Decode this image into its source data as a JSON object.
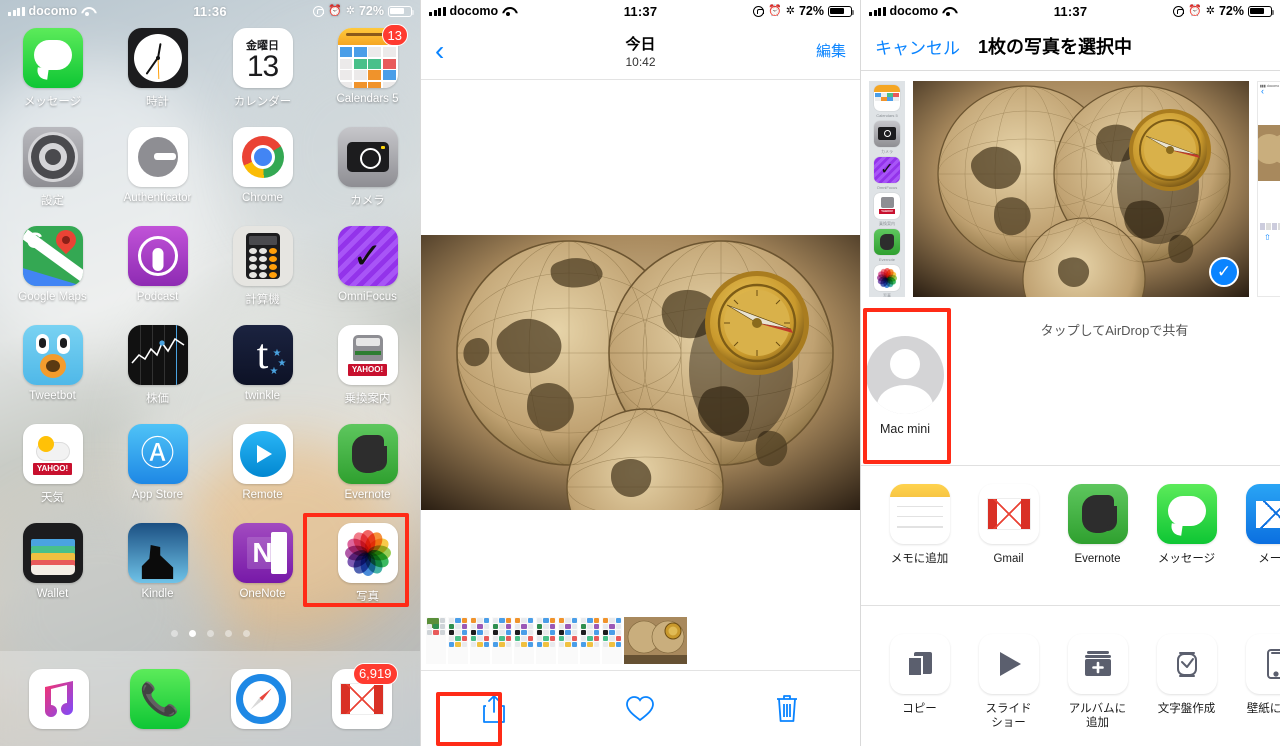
{
  "panel1": {
    "name": "ios-home-screen",
    "status": {
      "carrier": "docomo",
      "time": "11:36",
      "battery": "72%",
      "icons": [
        "rotation-lock-icon",
        "alarm-icon",
        "bluetooth-icon"
      ]
    },
    "apps": [
      {
        "label": "メッセージ",
        "icon": "messages-icon",
        "badge": ""
      },
      {
        "label": "時計",
        "icon": "clock-icon",
        "badge": ""
      },
      {
        "label": "カレンダー",
        "icon": "calendar-icon",
        "badge": "",
        "dow": "金曜日",
        "day": "13"
      },
      {
        "label": "Calendars 5",
        "icon": "calendars5-icon",
        "badge": "13"
      },
      {
        "label": "設定",
        "icon": "settings-icon",
        "badge": ""
      },
      {
        "label": "Authenticator",
        "icon": "authenticator-icon",
        "badge": ""
      },
      {
        "label": "Chrome",
        "icon": "chrome-icon",
        "badge": ""
      },
      {
        "label": "カメラ",
        "icon": "camera-icon",
        "badge": ""
      },
      {
        "label": "Google Maps",
        "icon": "google-maps-icon",
        "badge": ""
      },
      {
        "label": "Podcast",
        "icon": "podcasts-icon",
        "badge": ""
      },
      {
        "label": "計算機",
        "icon": "calculator-icon",
        "badge": ""
      },
      {
        "label": "OmniFocus",
        "icon": "omnifocus-icon",
        "badge": ""
      },
      {
        "label": "Tweetbot",
        "icon": "tweetbot-icon",
        "badge": ""
      },
      {
        "label": "株価",
        "icon": "stocks-icon",
        "badge": ""
      },
      {
        "label": "twinkle",
        "icon": "twinkle-icon",
        "badge": ""
      },
      {
        "label": "乗換案内",
        "icon": "norikae-annai-icon",
        "badge": ""
      },
      {
        "label": "天気",
        "icon": "yahoo-weather-icon",
        "badge": ""
      },
      {
        "label": "App Store",
        "icon": "app-store-icon",
        "badge": ""
      },
      {
        "label": "Remote",
        "icon": "remote-icon",
        "badge": ""
      },
      {
        "label": "Evernote",
        "icon": "evernote-icon",
        "badge": ""
      },
      {
        "label": "Wallet",
        "icon": "wallet-icon",
        "badge": ""
      },
      {
        "label": "Kindle",
        "icon": "kindle-icon",
        "badge": ""
      },
      {
        "label": "OneNote",
        "icon": "onenote-icon",
        "badge": ""
      },
      {
        "label": "写真",
        "icon": "photos-icon",
        "badge": ""
      }
    ],
    "page_dots": {
      "count": 5,
      "active_index": 1
    },
    "dock": [
      {
        "label": "",
        "icon": "music-icon",
        "badge": ""
      },
      {
        "label": "",
        "icon": "phone-icon",
        "badge": ""
      },
      {
        "label": "",
        "icon": "safari-icon",
        "badge": ""
      },
      {
        "label": "",
        "icon": "gmail-icon",
        "badge": "6,919"
      }
    ],
    "highlight": {
      "target": "写真",
      "color": "#ff2b17"
    }
  },
  "panel2": {
    "name": "photo-viewer",
    "status": {
      "carrier": "docomo",
      "time": "11:37",
      "battery": "72%"
    },
    "nav": {
      "back": "‹",
      "title": "今日",
      "subtitle": "10:42",
      "edit": "編集"
    },
    "photo_alt": "antique-world-map-with-compass",
    "toolbar": [
      {
        "name": "share-button",
        "icon": "share-icon"
      },
      {
        "name": "favorite-button",
        "icon": "heart-icon"
      },
      {
        "name": "delete-button",
        "icon": "trash-icon"
      }
    ],
    "highlight": {
      "target": "share-button",
      "color": "#ff2b17"
    }
  },
  "panel3": {
    "name": "share-sheet",
    "status": {
      "carrier": "docomo",
      "time": "11:37",
      "battery": "72%"
    },
    "nav": {
      "cancel": "キャンセル",
      "title": "1枚の写真を選択中"
    },
    "airdrop": {
      "hint": "タップしてAirDropで共有",
      "device": "Mac mini"
    },
    "apps": [
      {
        "label": "メモに追加",
        "icon": "notes-icon"
      },
      {
        "label": "Gmail",
        "icon": "gmail-icon"
      },
      {
        "label": "Evernote",
        "icon": "evernote-icon"
      },
      {
        "label": "メッセージ",
        "icon": "messages-icon"
      },
      {
        "label": "メール",
        "icon": "mail-icon"
      }
    ],
    "actions": [
      {
        "label": "コピー",
        "icon": "copy-icon"
      },
      {
        "label": "スライド\nショー",
        "icon": "play-icon"
      },
      {
        "label": "アルバムに\n追加",
        "icon": "add-to-album-icon"
      },
      {
        "label": "文字盤作成",
        "icon": "watch-face-icon"
      },
      {
        "label": "壁紙に設定",
        "icon": "wallpaper-icon"
      }
    ],
    "highlight": {
      "target": "Mac mini",
      "color": "#ff2b17"
    }
  }
}
